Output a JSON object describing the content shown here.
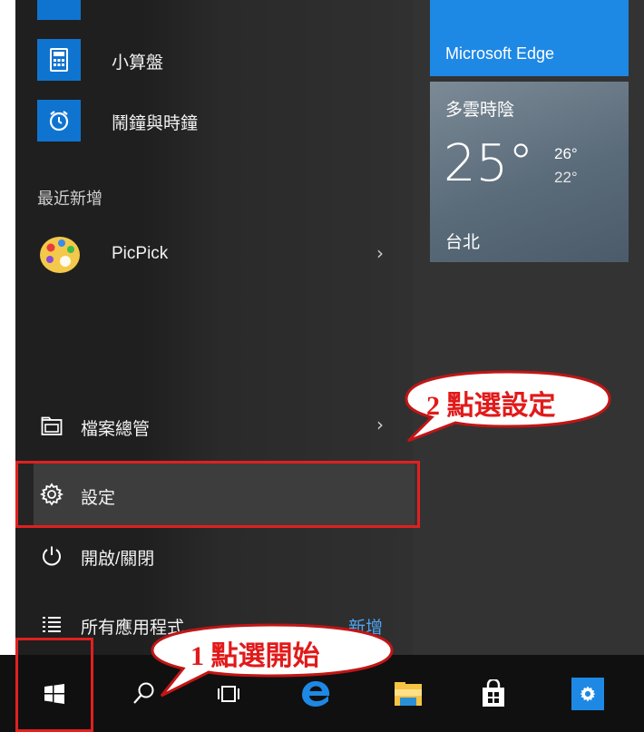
{
  "apps": {
    "calculator": "小算盤",
    "alarms": "鬧鐘與時鐘",
    "recent_header": "最近新增",
    "picpick": "PicPick"
  },
  "menu": {
    "file_explorer": "檔案總管",
    "settings": "設定",
    "power": "開啟/關閉",
    "all_apps": "所有應用程式",
    "new_badge": "新增"
  },
  "tiles": {
    "edge_label": "Microsoft Edge",
    "weather": {
      "condition": "多雲時陰",
      "temp": "25°",
      "high": "26°",
      "low": "22°",
      "city": "台北"
    }
  },
  "annotations": {
    "step1": "1 點選開始",
    "step2": "2 點選設定"
  },
  "colors": {
    "accent": "#0f74d0",
    "highlight_red": "#e02020",
    "edge_tile": "#1e88e5",
    "taskbar": "#101010"
  },
  "icons": [
    "calculator-icon",
    "alarm-clock-icon",
    "picpick-icon",
    "chevron-right-icon",
    "folder-icon",
    "gear-icon",
    "power-icon",
    "list-icon",
    "windows-logo-icon",
    "search-icon",
    "task-view-icon",
    "edge-icon",
    "file-explorer-icon",
    "store-icon",
    "settings-icon"
  ]
}
